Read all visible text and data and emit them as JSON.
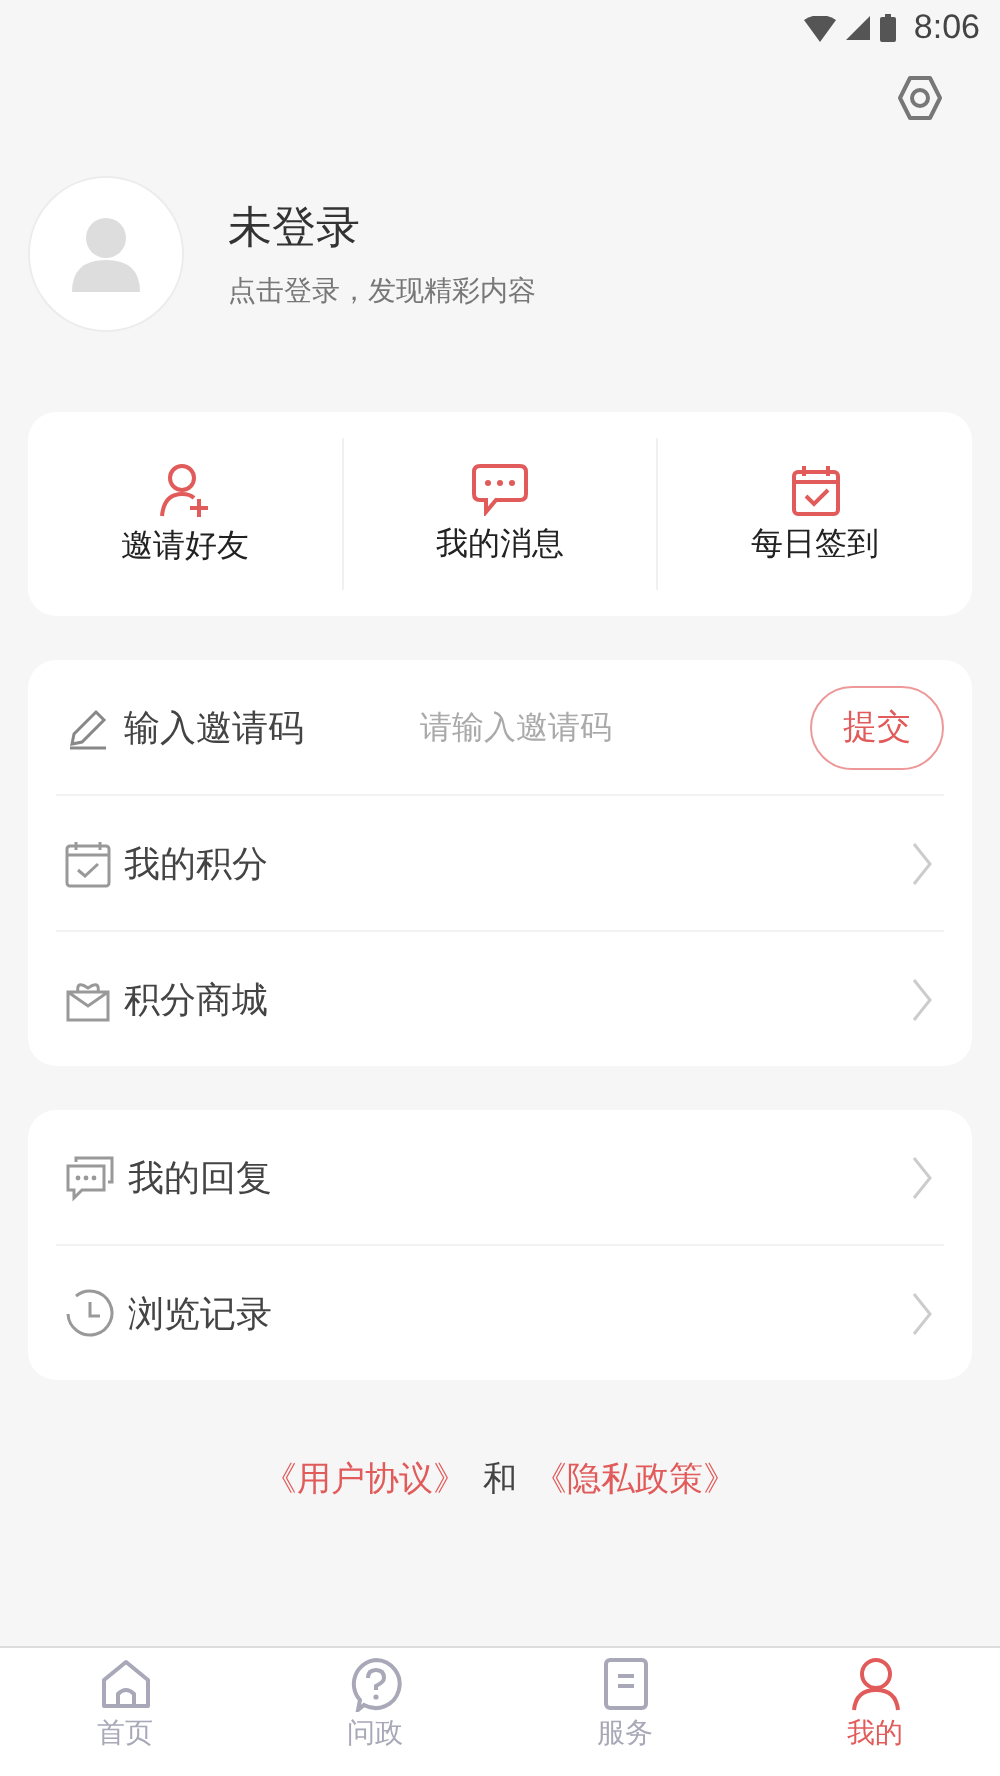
{
  "status_bar": {
    "time": "8:06"
  },
  "profile": {
    "name": "未登录",
    "subtitle": "点击登录，发现精彩内容"
  },
  "quick_actions": [
    {
      "kind": "invite",
      "label": "邀请好友"
    },
    {
      "kind": "message",
      "label": "我的消息"
    },
    {
      "kind": "checkin",
      "label": "每日签到"
    }
  ],
  "invite_code": {
    "label": "输入邀请码",
    "placeholder": "请输入邀请码",
    "button": "提交"
  },
  "menu_group_1": [
    {
      "kind": "points",
      "label": "我的积分"
    },
    {
      "kind": "shop",
      "label": "积分商城"
    }
  ],
  "menu_group_2": [
    {
      "kind": "reply",
      "label": "我的回复"
    },
    {
      "kind": "history",
      "label": "浏览记录"
    }
  ],
  "agreement": {
    "user_agreement": "《用户协议》",
    "conjunction": "和",
    "privacy_policy": "《隐私政策》"
  },
  "tab_bar": [
    {
      "kind": "home",
      "label": "首页",
      "selected": false
    },
    {
      "kind": "ask",
      "label": "问政",
      "selected": false
    },
    {
      "kind": "service",
      "label": "服务",
      "selected": false
    },
    {
      "kind": "me",
      "label": "我的",
      "selected": true
    }
  ]
}
